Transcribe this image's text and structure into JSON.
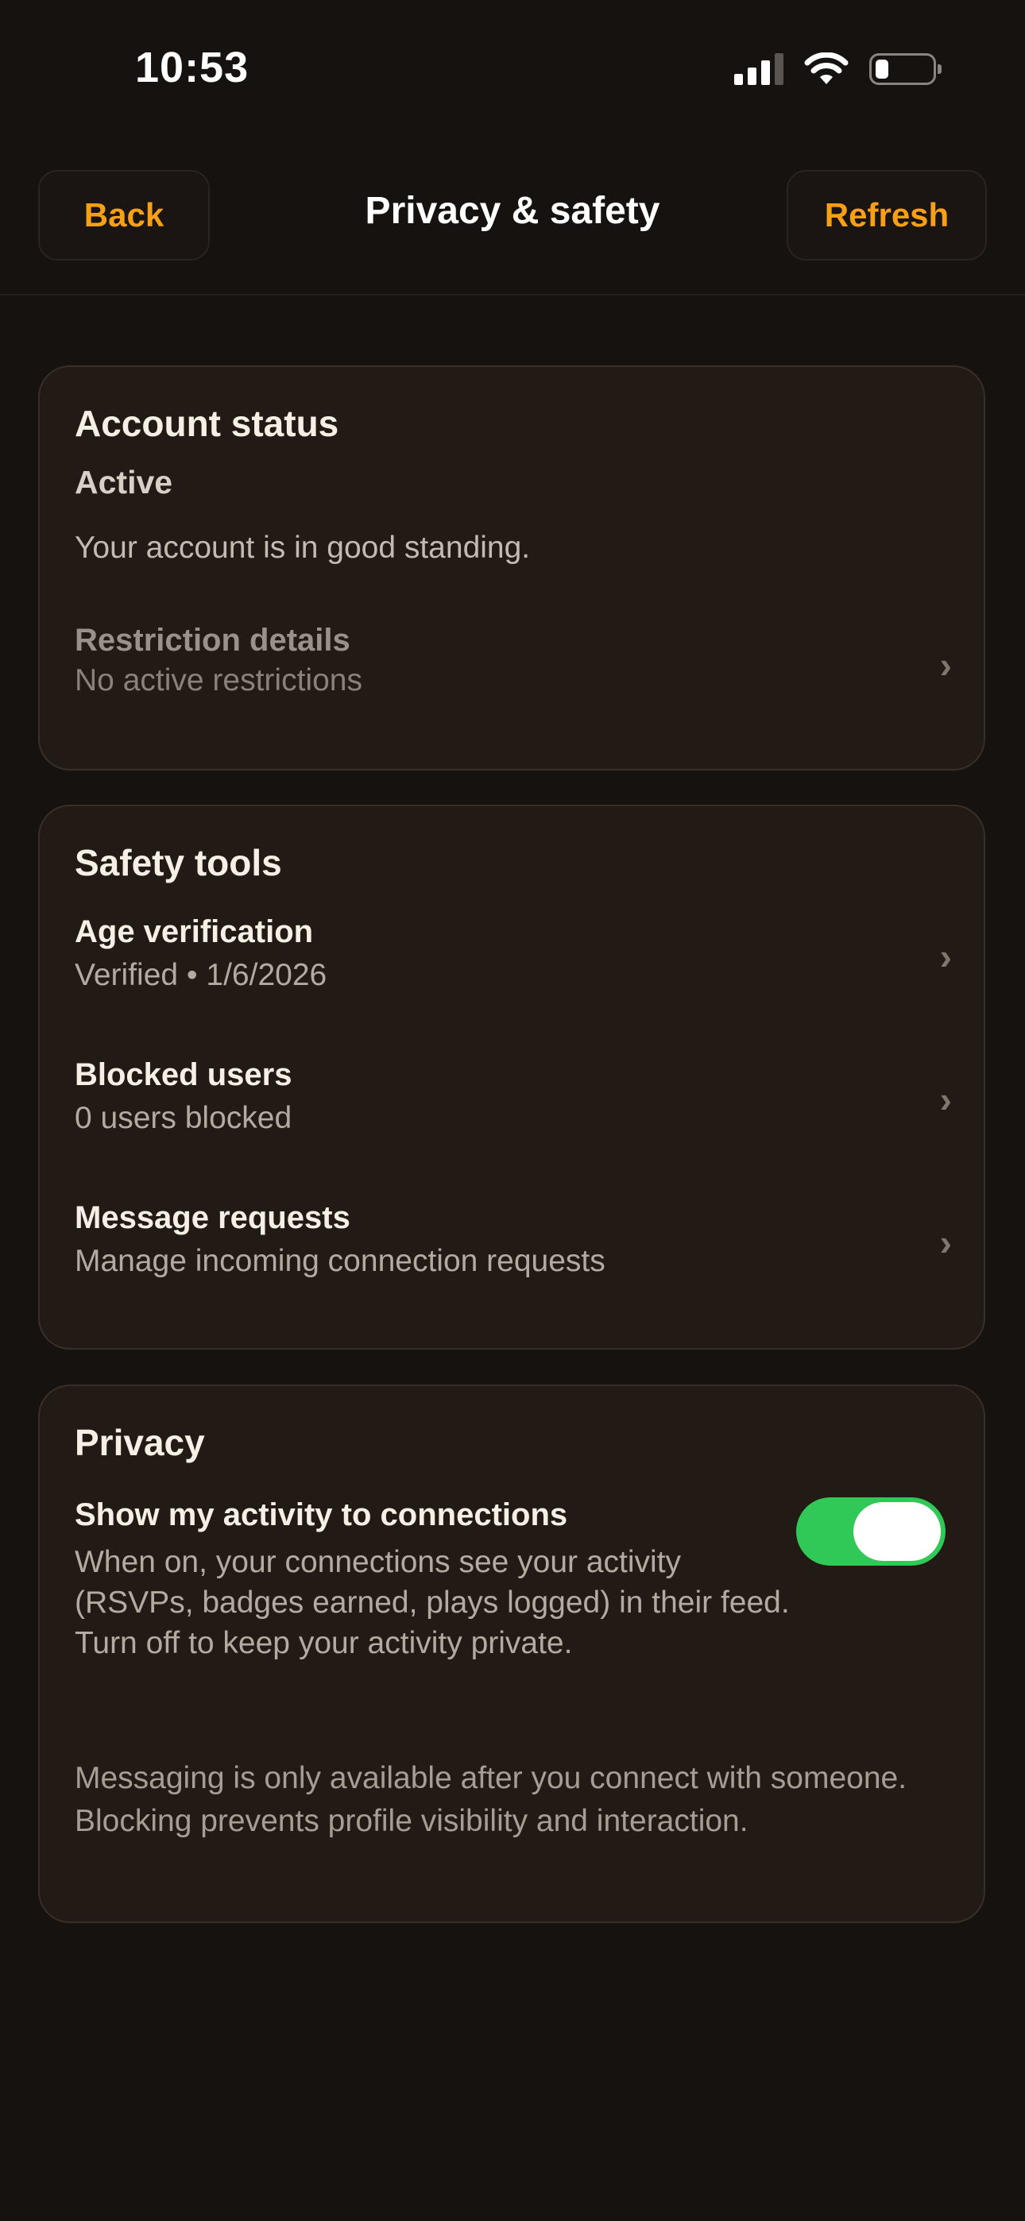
{
  "status_bar": {
    "time": "10:53",
    "icons": [
      "cellular-signal-icon",
      "wifi-icon",
      "battery-icon"
    ]
  },
  "nav": {
    "back_label": "Back",
    "title": "Privacy & safety",
    "refresh_label": "Refresh"
  },
  "account_status": {
    "title": "Account status",
    "status": "Active",
    "description": "Your account is in good standing.",
    "restriction": {
      "title": "Restriction details",
      "subtitle": "No active restrictions"
    }
  },
  "safety_tools": {
    "title": "Safety tools",
    "items": [
      {
        "title": "Age verification",
        "subtitle": "Verified • 1/6/2026"
      },
      {
        "title": "Blocked users",
        "subtitle": "0 users blocked"
      },
      {
        "title": "Message requests",
        "subtitle": "Manage incoming connection requests"
      }
    ]
  },
  "privacy": {
    "title": "Privacy",
    "activity_toggle": {
      "title": "Show my activity to connections",
      "description": "When on, your connections see your activity (RSVPs, badges earned, plays logged) in their feed. Turn off to keep your activity private.",
      "enabled": true
    },
    "footnote": "Messaging is only available after you connect with someone. Blocking prevents profile visibility and interaction."
  },
  "colors": {
    "background": "#161210",
    "card": "#221a14",
    "accent": "#f5a016",
    "toggle_on": "#30c957"
  }
}
